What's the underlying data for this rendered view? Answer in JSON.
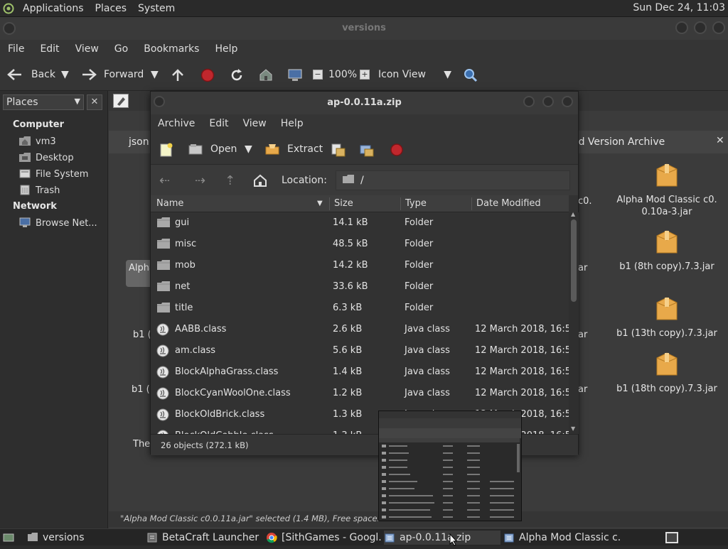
{
  "top_panel": {
    "menus": [
      "Applications",
      "Places",
      "System"
    ],
    "clock": "Sun Dec 24, 11:03"
  },
  "main_window": {
    "title": "versions",
    "menubar": [
      "File",
      "Edit",
      "View",
      "Go",
      "Bookmarks",
      "Help"
    ],
    "toolbar": {
      "back": "Back",
      "forward": "Forward",
      "zoom": "100%",
      "view_mode": "Icon View"
    },
    "sidebar": {
      "combo": "Places",
      "sections": [
        {
          "title": "Computer",
          "items": [
            "vm3",
            "Desktop",
            "File System",
            "Trash"
          ]
        },
        {
          "title": "Network",
          "items": [
            "Browse Net..."
          ]
        }
      ]
    },
    "tab_partial": "json",
    "tab_title": "od Version Archive",
    "left_labels": [
      "Alpha",
      "b1 (",
      "b1 (1",
      "The"
    ],
    "mid_labels": [
      "c0.",
      "ar",
      "ar",
      "ar"
    ],
    "right_icons": [
      {
        "label1": "Alpha Mod Classic c0.",
        "label2": "0.10a-3.jar"
      },
      {
        "label1": "b1 (8th copy).7.3.jar",
        "label2": ""
      },
      {
        "label1": "b1 (13th copy).7.3.jar",
        "label2": ""
      },
      {
        "label1": "b1 (18th copy).7.3.jar",
        "label2": ""
      }
    ],
    "status": "\"Alpha Mod Classic c0.0.11a.jar\" selected (1.4 MB), Free space: 28.2 GB"
  },
  "archive_window": {
    "title": "ap-0.0.11a.zip",
    "menubar": [
      "Archive",
      "Edit",
      "View",
      "Help"
    ],
    "toolbar": {
      "open": "Open",
      "extract": "Extract"
    },
    "location_label": "Location:",
    "location_value": "/",
    "columns": [
      "Name",
      "Size",
      "Type",
      "Date Modified"
    ],
    "rows": [
      {
        "name": "gui",
        "size": "14.1 kB",
        "type": "Folder",
        "date": "",
        "icon": "folder-icon"
      },
      {
        "name": "misc",
        "size": "48.5 kB",
        "type": "Folder",
        "date": "",
        "icon": "folder-icon"
      },
      {
        "name": "mob",
        "size": "14.2 kB",
        "type": "Folder",
        "date": "",
        "icon": "folder-icon"
      },
      {
        "name": "net",
        "size": "33.6 kB",
        "type": "Folder",
        "date": "",
        "icon": "folder-icon"
      },
      {
        "name": "title",
        "size": "6.3 kB",
        "type": "Folder",
        "date": "",
        "icon": "folder-icon"
      },
      {
        "name": "AABB.class",
        "size": "2.6 kB",
        "type": "Java class",
        "date": "12 March 2018, 16:58",
        "icon": "java-class-icon"
      },
      {
        "name": "am.class",
        "size": "5.6 kB",
        "type": "Java class",
        "date": "12 March 2018, 16:58",
        "icon": "java-class-icon"
      },
      {
        "name": "BlockAlphaGrass.class",
        "size": "1.4 kB",
        "type": "Java class",
        "date": "12 March 2018, 16:58",
        "icon": "java-class-icon"
      },
      {
        "name": "BlockCyanWoolOne.class",
        "size": "1.2 kB",
        "type": "Java class",
        "date": "12 March 2018, 16:58",
        "icon": "java-class-icon"
      },
      {
        "name": "BlockOldBrick.class",
        "size": "1.3 kB",
        "type": "Java class",
        "date": "12 March 2018, 16:58",
        "icon": "java-class-icon"
      },
      {
        "name": "BlockOldCobble.class",
        "size": "1.3 kB",
        "type": "Java class",
        "date": "12 March 2018, 16:58",
        "icon": "java-class-icon"
      }
    ],
    "status": "26 objects (272.1 kB)"
  },
  "taskbar": {
    "tasks": [
      "versions",
      "BetaCraft Launcher ...",
      "[SithGames - Googl...",
      "ap-0.0.11a.zip",
      "Alpha Mod Classic c..."
    ]
  },
  "colors": {
    "panel": "#2a2a2a",
    "window": "#353535",
    "folder": "#a8a8a8",
    "jar": "#e8a94a",
    "stop": "#c0272d"
  }
}
